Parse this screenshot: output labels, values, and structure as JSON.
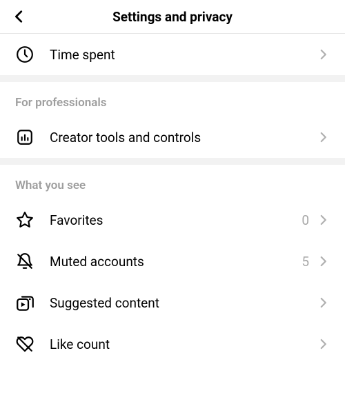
{
  "header": {
    "title": "Settings and privacy"
  },
  "rows": {
    "time_spent": {
      "label": "Time spent"
    },
    "creator_tools": {
      "label": "Creator tools and controls"
    },
    "favorites": {
      "label": "Favorites",
      "count": "0"
    },
    "muted": {
      "label": "Muted accounts",
      "count": "5"
    },
    "suggested": {
      "label": "Suggested content"
    },
    "like_count": {
      "label": "Like count"
    }
  },
  "sections": {
    "professionals": "For professionals",
    "what_you_see": "What you see"
  }
}
